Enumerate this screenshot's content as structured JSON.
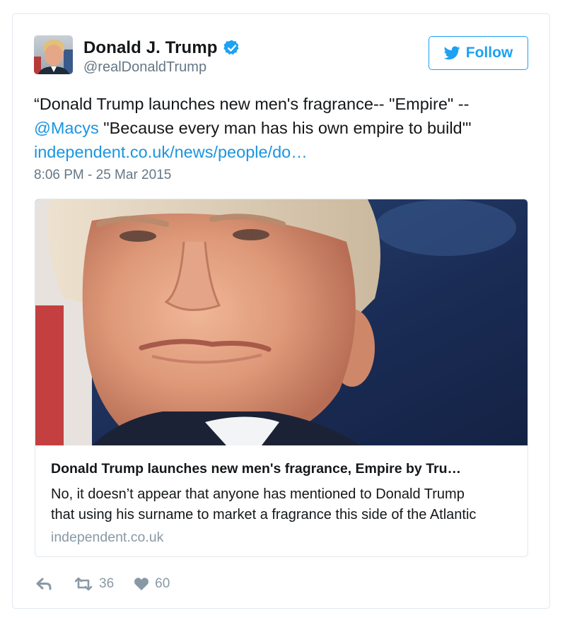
{
  "user": {
    "display_name": "Donald J. Trump",
    "handle": "@realDonaldTrump",
    "verified_icon": "verified-badge-icon",
    "avatar_icon": "avatar"
  },
  "follow_button": {
    "label": "Follow",
    "icon": "twitter-bird-icon"
  },
  "tweet": {
    "line1": "“Donald Trump launches new men's fragrance-- \"Empire\" --",
    "mention": "@Macys",
    "line2_rest": " \"Because every man has his own empire to build'\"",
    "url_text": "independent.co.uk/news/people/do…",
    "timestamp": "8:06 PM - 25 Mar 2015"
  },
  "card": {
    "image": "portrait-photo",
    "title": "Donald Trump launches new men's fragrance, Empire by Tru…",
    "description_line1": "No, it doesn’t appear that anyone has mentioned to Donald Trump",
    "description_line2": "that using his surname to market a fragrance this side of the Atlantic",
    "domain": "independent.co.uk"
  },
  "actions": {
    "reply_icon": "reply-icon",
    "retweet_icon": "retweet-icon",
    "retweet_count": "36",
    "like_icon": "heart-icon",
    "like_count": "60"
  },
  "colors": {
    "brand_blue": "#1da1f2",
    "link_blue": "#1b95e0",
    "secondary_text": "#657786",
    "muted_text": "#8899a6",
    "border": "#e1e8ed"
  }
}
